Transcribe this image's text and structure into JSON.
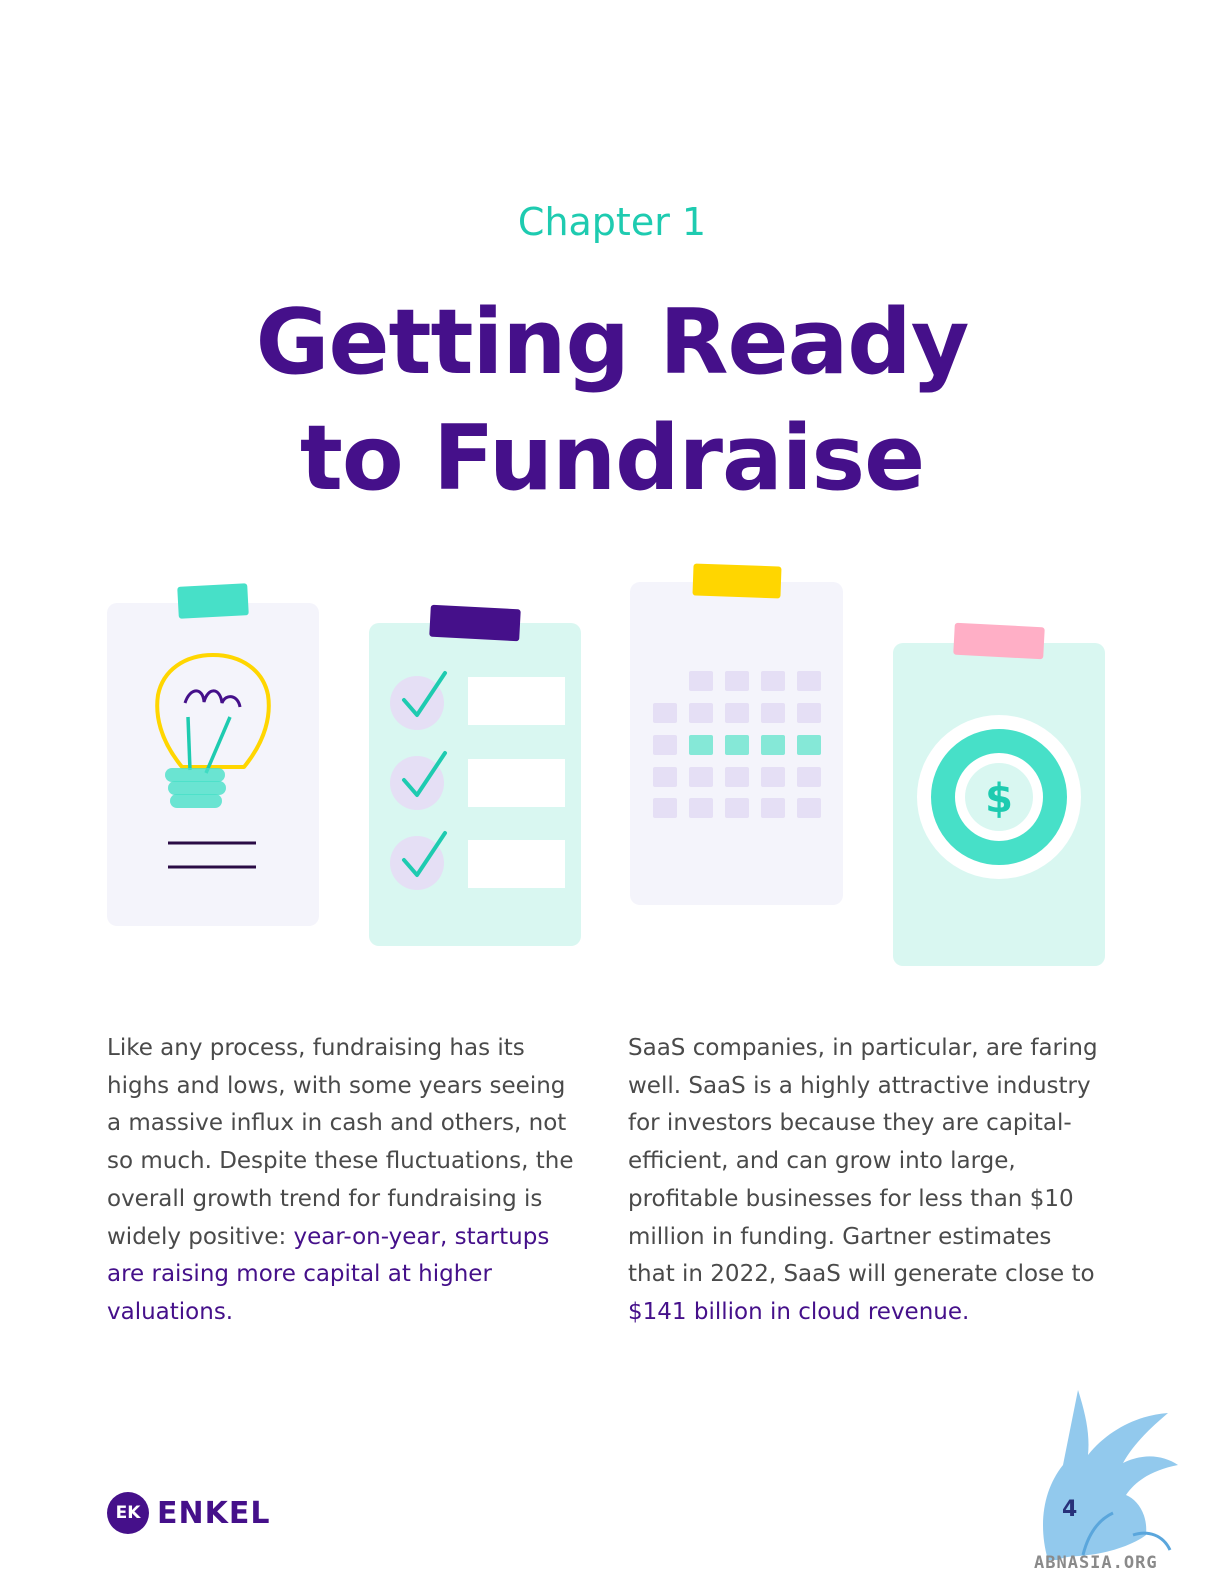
{
  "header": {
    "chapter": "Chapter 1",
    "title_line1": "Getting Ready",
    "title_line2": "to Fundraise"
  },
  "illustration": {
    "cards": [
      "lightbulb-card",
      "checklist-card",
      "calendar-card",
      "money-card"
    ],
    "checklist_icon": "checkmark-icon",
    "money_symbol": "$",
    "colors": {
      "teal": "#47e0c8",
      "purple": "#45108a",
      "yellow": "#ffd600",
      "pink": "#ffafc6",
      "card_light": "#f4f4fb",
      "card_mint": "#d9f7f1",
      "lavender": "#e5dff5"
    }
  },
  "body": {
    "left_plain": "Like any process, fundraising has its highs and lows, with some years seeing a massive influx in cash and others, not so much. Despite these fluctuations, the overall growth trend for fundraising is widely positive: ",
    "left_highlight": "year-on-year, startups are raising more capital at higher valuations.",
    "right_plain": "SaaS companies, in particular, are faring well. SaaS is a highly attractive industry for investors because they are capital-efficient, and can grow into large, profitable businesses for less than $10 million in funding. Gartner estimates that in 2022, SaaS will generate close to ",
    "right_highlight": "$141 billion in cloud revenue."
  },
  "footer": {
    "logo_mark": "EK",
    "logo_text": "ENKEL",
    "page_number": "4",
    "watermark_text": "ABNASIA.ORG"
  }
}
